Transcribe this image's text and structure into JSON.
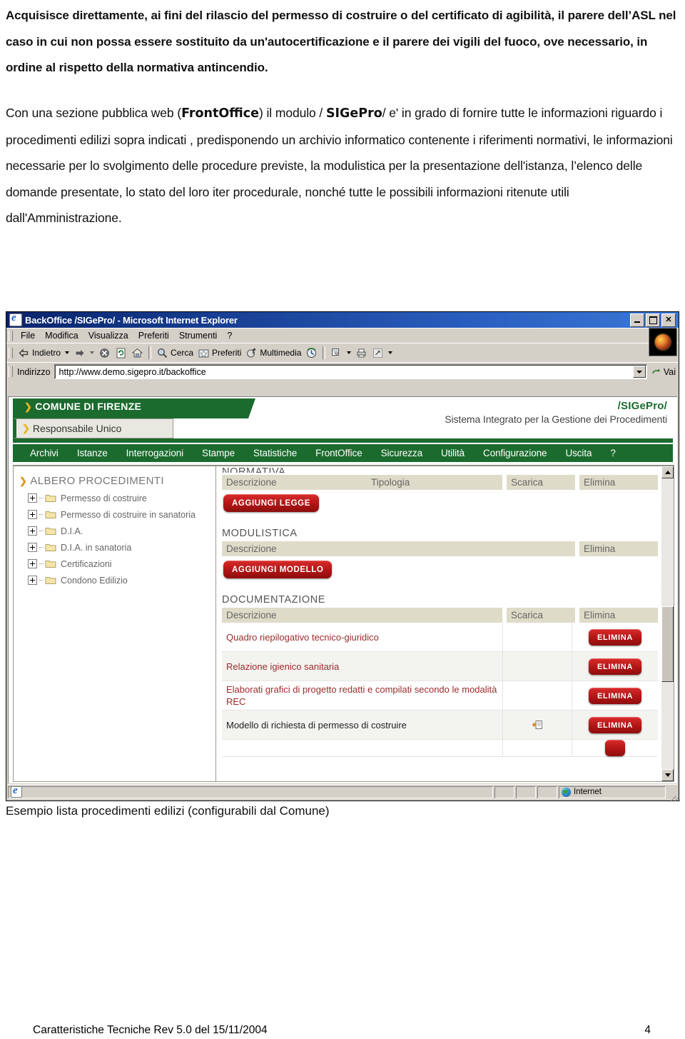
{
  "document": {
    "paragraph1": "Acquisisce direttamente, ai fini del rilascio del permesso di costruire o del certificato di agibilità, il parere dell’ASL nel caso in cui non possa essere sostituito da un'autocertificazione e il parere dei vigili del fuoco, ove necessario, in ordine al rispetto della normativa antincendio.",
    "paragraph2_part1": "Con una sezione pubblica web (",
    "paragraph2_bold1": "FrontOffice",
    "paragraph2_part2": ") il modulo / ",
    "paragraph2_bold2": "SIGePro",
    "paragraph2_part3": "/  e' in grado di fornire tutte le informazioni riguardo i procedimenti edilizi sopra indicati , predisponendo un archivio informatico contenente i riferimenti normativi, le informazioni necessarie per lo svolgimento delle procedure previste, la modulistica per la presentazione dell'istanza, l’elenco delle domande presentate, lo stato del loro iter procedurale, nonché tutte le possibili informazioni ritenute utili dall'Amministrazione.",
    "caption": "Esempio lista procedimenti edilizi (configurabili dal Comune)",
    "footer_left": "Caratteristiche Tecniche Rev 5.0 del 15/11/2004",
    "footer_page": "4"
  },
  "browser": {
    "title": "BackOffice /SIGePro/ - Microsoft Internet Explorer",
    "window_buttons": {
      "minimize": "minimize-icon",
      "maximize": "maximize-icon",
      "close": "close-icon"
    },
    "menu": [
      "File",
      "Modifica",
      "Visualizza",
      "Preferiti",
      "Strumenti",
      "?"
    ],
    "toolbar": [
      {
        "label": "Indietro",
        "icon": "back-arrow-icon",
        "has_dropdown": true
      },
      {
        "label": "",
        "icon": "forward-arrow-icon",
        "has_dropdown": true
      },
      {
        "label": "",
        "icon": "stop-icon",
        "has_dropdown": false
      },
      {
        "label": "",
        "icon": "refresh-icon",
        "has_dropdown": false
      },
      {
        "label": "",
        "icon": "home-icon",
        "has_dropdown": false
      },
      {
        "label": "Cerca",
        "icon": "search-icon",
        "has_dropdown": false
      },
      {
        "label": "Preferiti",
        "icon": "favorites-icon",
        "has_dropdown": false
      },
      {
        "label": "Multimedia",
        "icon": "multimedia-icon",
        "has_dropdown": false
      },
      {
        "label": "",
        "icon": "history-icon",
        "has_dropdown": false
      },
      {
        "label": "",
        "icon": "mail-icon",
        "has_dropdown": true
      },
      {
        "label": "",
        "icon": "print-icon",
        "has_dropdown": false
      },
      {
        "label": "",
        "icon": "edit-icon",
        "has_dropdown": true
      }
    ],
    "address_label": "Indirizzo",
    "address_value": "http://www.demo.sigepro.it/backoffice",
    "go_label": "Vai",
    "status": {
      "zone": "Internet"
    }
  },
  "app": {
    "comune": "COMUNE DI FIRENZE",
    "role_tab": "Responsabile Unico",
    "brand": "/SIGePro/",
    "brand_subtitle": "Sistema Integrato per la Gestione dei Procedimenti",
    "nav": [
      "Archivi",
      "Istanze",
      "Interrogazioni",
      "Stampe",
      "Statistiche",
      "FrontOffice",
      "Sicurezza",
      "Utilità",
      "Configurazione",
      "Uscita",
      "?"
    ],
    "accent_green": "#1b6b2e",
    "accent_red": "#b01414",
    "tree": {
      "title": "ALBERO PROCEDIMENTI",
      "items": [
        "Permesso di costruire",
        "Permesso di costruire in sanatoria",
        "D.I.A.",
        "D.I.A. in sanatoria",
        "Certificazioni",
        "Condono Edilizio"
      ]
    },
    "sections": {
      "normativa": {
        "title": "NORMATIVA",
        "columns": [
          "Descrizione",
          "Tipologia",
          "Scarica",
          "Elimina"
        ],
        "add_button": "AGGIUNGI LEGGE",
        "rows": []
      },
      "modulistica": {
        "title": "MODULISTICA",
        "columns": [
          "Descrizione",
          "Elimina"
        ],
        "add_button": "AGGIUNGI MODELLO",
        "rows": []
      },
      "documentazione": {
        "title": "DOCUMENTAZIONE",
        "columns": [
          "Descrizione",
          "Scarica",
          "Elimina"
        ],
        "rows": [
          {
            "descrizione": "Quadro riepilogativo tecnico-giuridico",
            "scarica": "",
            "elimina": "ELIMINA"
          },
          {
            "descrizione": "Relazione igienico sanitaria",
            "scarica": "",
            "elimina": "ELIMINA"
          },
          {
            "descrizione": "Elaborati grafici di progetto redatti e compilati secondo le modalità REC",
            "scarica": "",
            "elimina": "ELIMINA"
          },
          {
            "descrizione": "Modello di richiesta di permesso di costruire",
            "scarica": "download-icon",
            "elimina": "ELIMINA"
          }
        ]
      }
    }
  }
}
